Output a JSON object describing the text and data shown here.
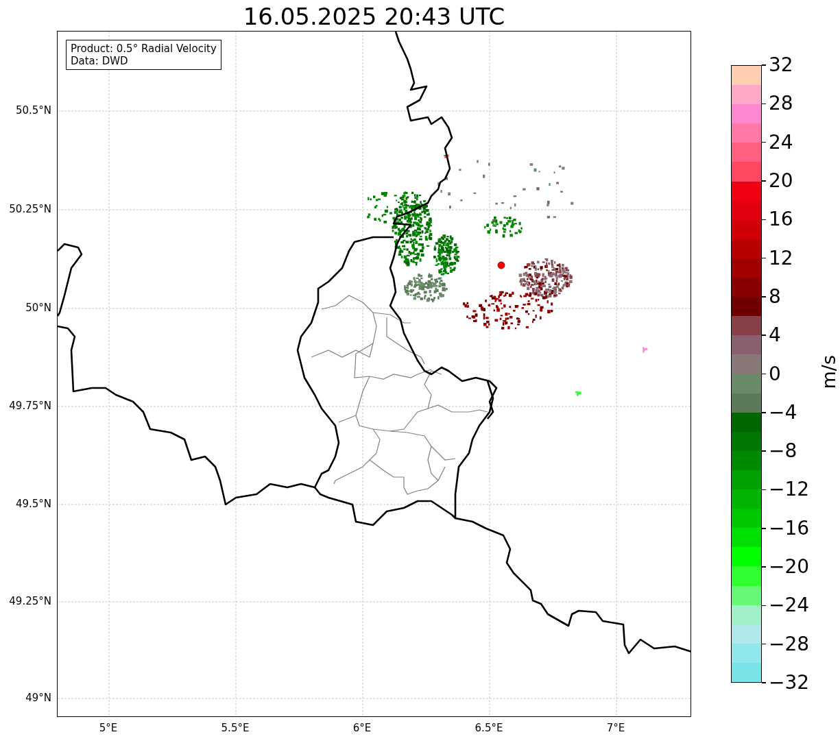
{
  "title": "16.05.2025 20:43 UTC",
  "info_box": {
    "lines": [
      "Product: 0.5° Radial Velocity",
      "Data: DWD"
    ]
  },
  "map": {
    "lat_labels": [
      "50.5°N",
      "50.25°N",
      "50°N",
      "49.75°N",
      "49.5°N",
      "49.25°N",
      "49°N"
    ],
    "lon_labels": [
      "5°E",
      "5.5°E",
      "6°E",
      "6.5°E",
      "7°E"
    ]
  },
  "colorbar": {
    "label": "m/s",
    "ticks": [
      "32",
      "28",
      "24",
      "20",
      "16",
      "12",
      "8",
      "4",
      "0",
      "−4",
      "−8",
      "−12",
      "−16",
      "−20",
      "−24",
      "−28",
      "−32"
    ],
    "segments": [
      {
        "color": "#ffcfb0"
      },
      {
        "color": "#ffa8c8"
      },
      {
        "color": "#ff88d0"
      },
      {
        "color": "#ff78a8"
      },
      {
        "color": "#ff6080"
      },
      {
        "color": "#ff4860"
      },
      {
        "color": "#f00010"
      },
      {
        "color": "#e00010"
      },
      {
        "color": "#d00008"
      },
      {
        "color": "#b80000"
      },
      {
        "color": "#a00000"
      },
      {
        "color": "#880000"
      },
      {
        "color": "#700000"
      },
      {
        "color": "#884048"
      },
      {
        "color": "#886070"
      },
      {
        "color": "#887878"
      },
      {
        "color": "#6a8a6a"
      },
      {
        "color": "#5a7a5a"
      },
      {
        "color": "#006600"
      },
      {
        "color": "#007700"
      },
      {
        "color": "#008a00"
      },
      {
        "color": "#00a000"
      },
      {
        "color": "#00b400"
      },
      {
        "color": "#00c800"
      },
      {
        "color": "#00e000"
      },
      {
        "color": "#00ff00"
      },
      {
        "color": "#30ff30"
      },
      {
        "color": "#68f878"
      },
      {
        "color": "#a0f0c8"
      },
      {
        "color": "#b0e8ec"
      },
      {
        "color": "#90e8ec"
      },
      {
        "color": "#78e4e8"
      }
    ]
  }
}
